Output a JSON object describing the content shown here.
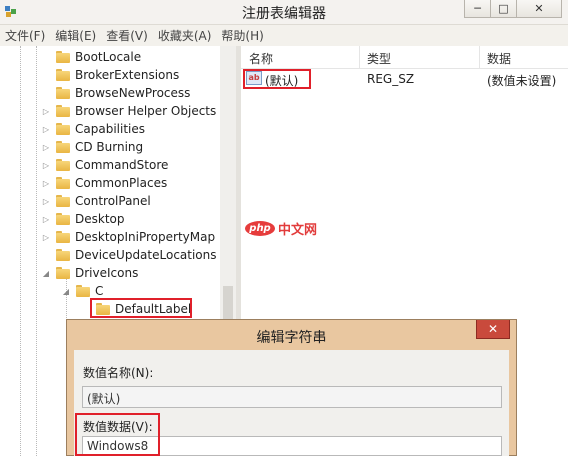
{
  "window": {
    "title": "注册表编辑器",
    "controls": {
      "minimize": "─",
      "maximize": "□",
      "close": "✕"
    }
  },
  "menu": [
    "文件(F)",
    "编辑(E)",
    "查看(V)",
    "收藏夹(A)",
    "帮助(H)"
  ],
  "tree": {
    "items": [
      {
        "label": "BootLocale",
        "expander": ""
      },
      {
        "label": "BrokerExtensions",
        "expander": ""
      },
      {
        "label": "BrowseNewProcess",
        "expander": ""
      },
      {
        "label": "Browser Helper Objects",
        "expander": "▷"
      },
      {
        "label": "Capabilities",
        "expander": "▷"
      },
      {
        "label": "CD Burning",
        "expander": "▷"
      },
      {
        "label": "CommandStore",
        "expander": "▷"
      },
      {
        "label": "CommonPlaces",
        "expander": "▷"
      },
      {
        "label": "ControlPanel",
        "expander": "▷"
      },
      {
        "label": "Desktop",
        "expander": "▷"
      },
      {
        "label": "DesktopIniPropertyMap",
        "expander": "▷"
      },
      {
        "label": "DeviceUpdateLocations",
        "expander": ""
      },
      {
        "label": "DriveIcons",
        "expander": "◢"
      },
      {
        "label": "C",
        "expander": "◢"
      },
      {
        "label": "DefaultLabel",
        "expander": ""
      }
    ]
  },
  "list": {
    "headers": {
      "name": "名称",
      "type": "类型",
      "data": "数据"
    },
    "rows": [
      {
        "icon": "ab",
        "name": "(默认)",
        "type": "REG_SZ",
        "data": "(数值未设置)"
      }
    ]
  },
  "watermark": {
    "badge": "php",
    "text": "中文网"
  },
  "dialog": {
    "title": "编辑字符串",
    "close": "✕",
    "name_label": "数值名称(N):",
    "name_value": "(默认)",
    "data_label": "数值数据(V):",
    "data_value": "Windows8"
  },
  "colors": {
    "highlight": "#e0202a",
    "folder": "#f0c55a",
    "dialog_frame": "#e9c7a0",
    "close_button": "#c94a3c"
  }
}
